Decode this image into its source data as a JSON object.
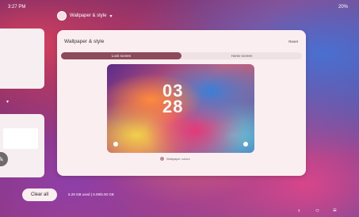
{
  "status_bar": {
    "time": "3:27 PM",
    "right": "20%"
  },
  "app_chip": {
    "title": "Wallpaper & style",
    "caret": "▾"
  },
  "main_card": {
    "title": "Wallpaper & style",
    "reset_label": "Reset",
    "tabs": [
      {
        "label": "Lock screen",
        "active": true
      },
      {
        "label": "Home screen",
        "active": false
      }
    ],
    "preview": {
      "clock_line1": "03",
      "clock_line2": "28"
    },
    "color_button_label": "Wallpaper colors"
  },
  "bottom_bar": {
    "clear_all_label": "Clear all",
    "storage_text": "5.29 GB used | 6.09/6.00 GB"
  },
  "nav": {
    "back": "‹",
    "home": "○",
    "recent": "≡"
  },
  "left_cards": {
    "caret": "▾",
    "edit_glyph": "✎"
  }
}
